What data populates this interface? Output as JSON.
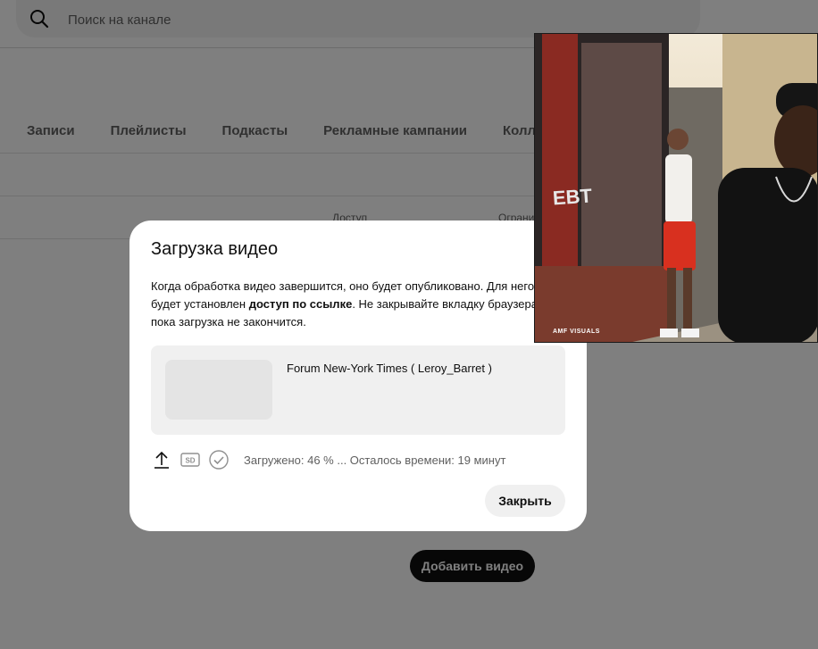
{
  "search": {
    "placeholder": "Поиск на канале"
  },
  "tabs": [
    {
      "label": "Записи"
    },
    {
      "label": "Плейлисты"
    },
    {
      "label": "Подкасты"
    },
    {
      "label": "Рекламные кампании"
    },
    {
      "label": "Коллаб"
    }
  ],
  "table": {
    "columns": [
      "Доступ",
      "Ограни"
    ]
  },
  "add_video_label": "Добавить видео",
  "dialog": {
    "title": "Загрузка видео",
    "message_part1": "Когда обработка видео завершится, оно будет опубликовано. Для него будет установлен ",
    "message_bold": "доступ по ссылке",
    "message_part2": ". Не закрывайте вкладку браузера, пока загрузка не закончится.",
    "video_title": "Forum New-York Times ( Leroy_Barret )",
    "status_text": "Загружено: 46 % ... Осталось времени: 19 минут",
    "upload_progress_percent": 46,
    "sd_badge": "SD",
    "close_label": "Закрыть"
  },
  "pip": {
    "watermark": "AMF VISUALS",
    "sign_text": "EBT"
  },
  "colors": {
    "scrim": "#000000",
    "primary_button": "#0f0f0f",
    "card_bg": "#f0f0f0",
    "secondary_text": "#606060"
  }
}
